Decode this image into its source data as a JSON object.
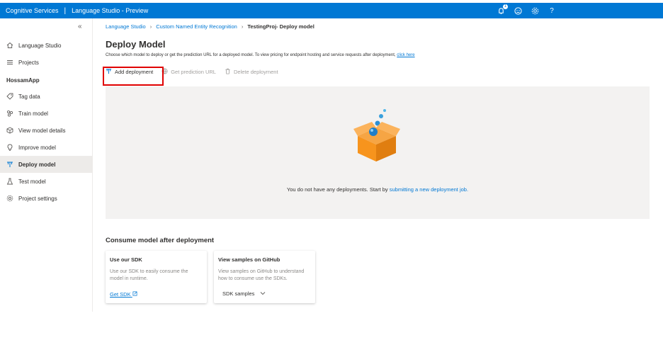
{
  "topbar": {
    "service": "Cognitive Services",
    "separator": "|",
    "app_title": "Language Studio - Preview",
    "notification_count": "1"
  },
  "sidebar": {
    "collapse_glyph": "«",
    "top_items": [
      {
        "label": "Language Studio",
        "icon": "home-icon"
      },
      {
        "label": "Projects",
        "icon": "list-icon"
      }
    ],
    "group_label": "HossamApp",
    "items": [
      {
        "label": "Tag data",
        "icon": "tag-icon"
      },
      {
        "label": "Train model",
        "icon": "train-icon"
      },
      {
        "label": "View model details",
        "icon": "box-icon"
      },
      {
        "label": "Improve model",
        "icon": "lightbulb-icon"
      },
      {
        "label": "Deploy model",
        "icon": "deploy-icon",
        "active": true
      },
      {
        "label": "Test model",
        "icon": "flask-icon"
      },
      {
        "label": "Project settings",
        "icon": "gear-icon"
      }
    ]
  },
  "breadcrumb": {
    "items": [
      "Language Studio",
      "Custom Named Entity Recognition"
    ],
    "current": "TestingProj- Deploy model"
  },
  "page": {
    "title": "Deploy Model",
    "description": "Choose which model to deploy or get the prediction URL for a deployed model. To view pricing for endpoint hosting and service requests after deployment,",
    "description_link": "click here"
  },
  "toolbar": {
    "add_label": "Add deployment",
    "get_url_label": "Get prediction URL",
    "delete_label": "Delete deployment"
  },
  "empty_state": {
    "text": "You do not have any deployments. Start by",
    "link": "submitting a new deployment job."
  },
  "consume": {
    "title": "Consume model after deployment",
    "cards": [
      {
        "title": "Use our SDK",
        "description": "Use our SDK to easily consume the model in runtime.",
        "action": "Get SDK"
      },
      {
        "title": "View samples on GitHub",
        "description": "View samples on GitHub to understand how to consume use the SDKs.",
        "action": "SDK samples"
      }
    ]
  },
  "colors": {
    "accent": "#0078d4",
    "highlight": "#e00000",
    "box": "#f7941d"
  }
}
